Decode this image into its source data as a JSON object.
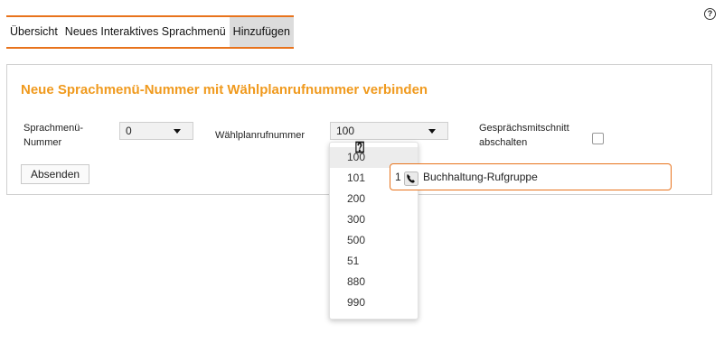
{
  "help": {
    "glyph": "?"
  },
  "tabs": [
    {
      "label": "Übersicht",
      "active": false
    },
    {
      "label": "Neues Interaktives Sprachmenü",
      "active": false
    },
    {
      "label": "Hinzufügen",
      "active": true
    }
  ],
  "form": {
    "title": "Neue Sprachmenü-Nummer mit Wählplanrufnummer verbinden",
    "menu_number_label_line1": "Sprachmenü-",
    "menu_number_label_line2": "Nummer",
    "menu_number_value": "0",
    "dial_plan_label": "Wählplanrufnummer",
    "dial_plan_value": "100",
    "recording_label_line1": "Gesprächsmitschnitt",
    "recording_label_line2": "abschalten",
    "recording_checked": false,
    "submit_label": "Absenden"
  },
  "dropdown": {
    "options": [
      "100",
      "101",
      "200",
      "300",
      "500",
      "51",
      "880",
      "990"
    ],
    "hovered_index": 0
  },
  "tooltip": {
    "number": "1",
    "icon": "phone-icon",
    "name": "Buchhaltung-Rufgruppe"
  },
  "colors": {
    "accent": "#e8731c",
    "title": "#f09a1e"
  }
}
